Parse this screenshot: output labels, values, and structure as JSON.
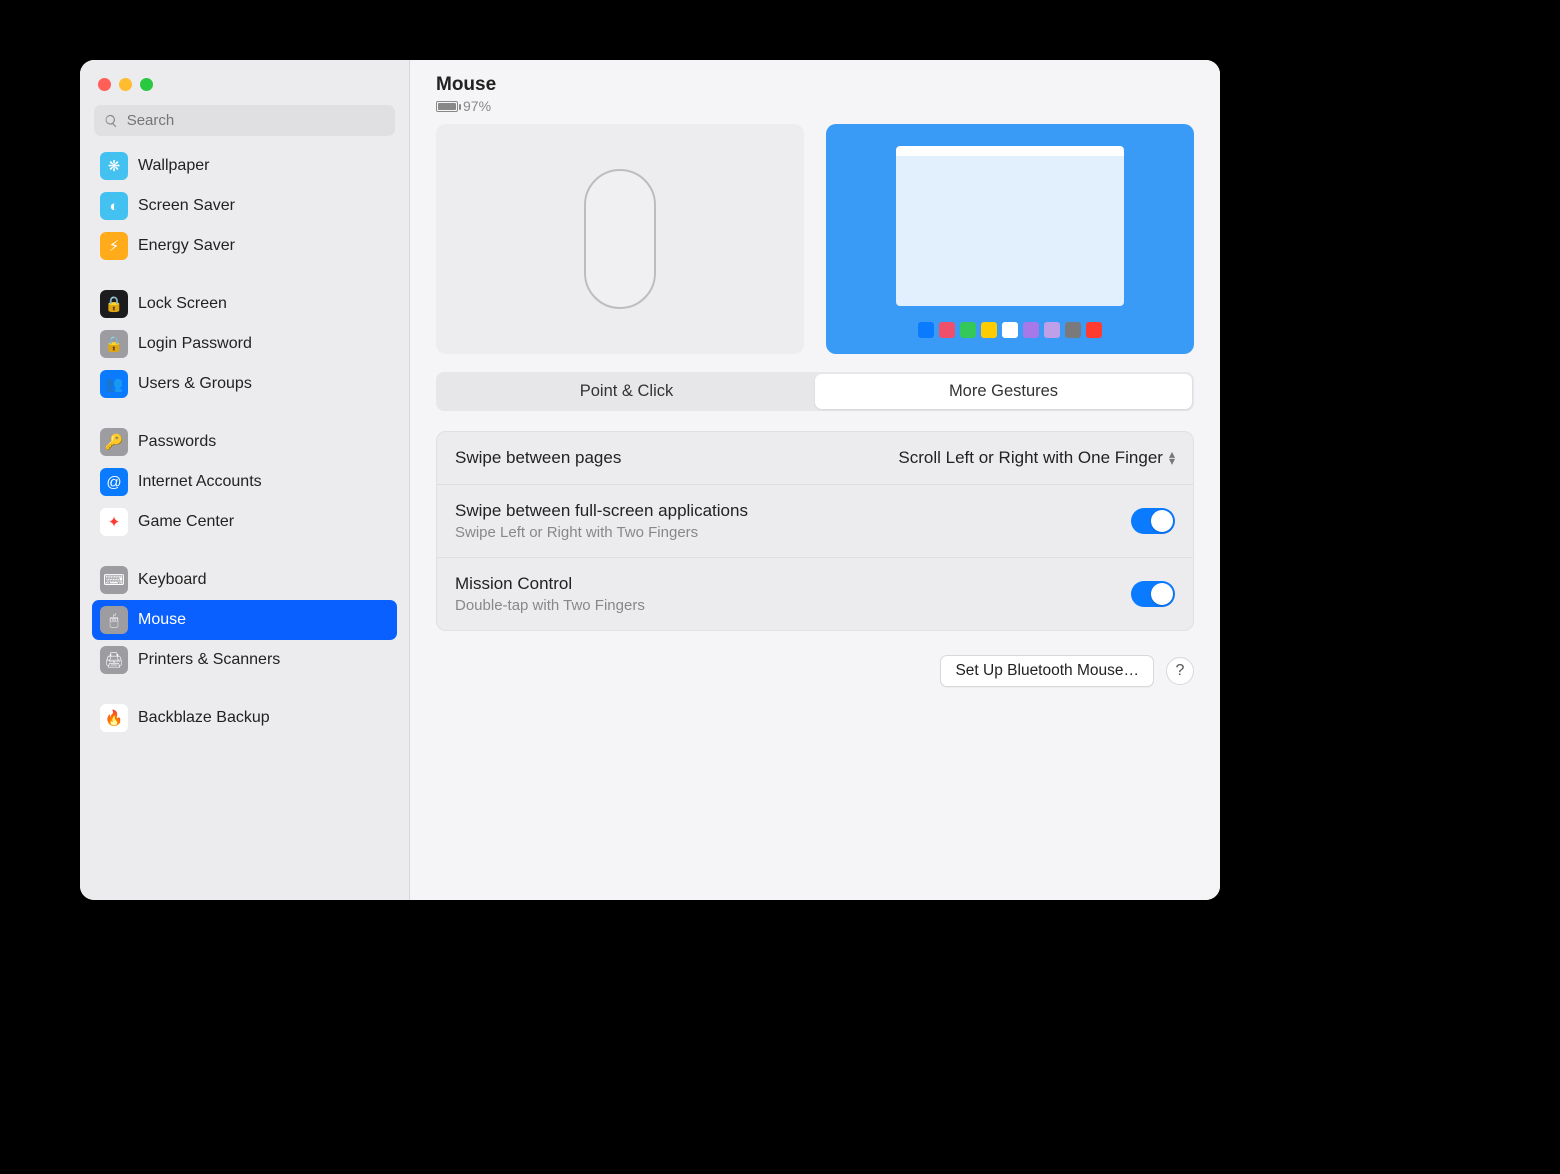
{
  "search": {
    "placeholder": "Search"
  },
  "sidebar": {
    "groups": [
      {
        "items": [
          {
            "id": "wallpaper",
            "label": "Wallpaper",
            "icon": "❋",
            "bg": "#43c1f0"
          },
          {
            "id": "screen-saver",
            "label": "Screen Saver",
            "icon": "◐",
            "bg": "#43c1f0"
          },
          {
            "id": "energy-saver",
            "label": "Energy Saver",
            "icon": "⚡︎",
            "bg": "#ffab1a"
          }
        ]
      },
      {
        "items": [
          {
            "id": "lock-screen",
            "label": "Lock Screen",
            "icon": "🔒",
            "bg": "#1c1c1e"
          },
          {
            "id": "login-password",
            "label": "Login Password",
            "icon": "🔒",
            "bg": "#9c9ca1"
          },
          {
            "id": "users-groups",
            "label": "Users & Groups",
            "icon": "👥",
            "bg": "#0a7aff"
          }
        ]
      },
      {
        "items": [
          {
            "id": "passwords",
            "label": "Passwords",
            "icon": "🔑",
            "bg": "#9c9ca1"
          },
          {
            "id": "internet-accounts",
            "label": "Internet Accounts",
            "icon": "@",
            "bg": "#0a7aff"
          },
          {
            "id": "game-center",
            "label": "Game Center",
            "icon": "✦",
            "bg": "#ffffff"
          }
        ]
      },
      {
        "items": [
          {
            "id": "keyboard",
            "label": "Keyboard",
            "icon": "⌨",
            "bg": "#9c9ca1"
          },
          {
            "id": "mouse",
            "label": "Mouse",
            "icon": "🖱",
            "bg": "#9c9ca1",
            "selected": true
          },
          {
            "id": "printers-scanners",
            "label": "Printers & Scanners",
            "icon": "🖨",
            "bg": "#9c9ca1"
          }
        ]
      },
      {
        "items": [
          {
            "id": "backblaze",
            "label": "Backblaze Backup",
            "icon": "🔥",
            "bg": "#ffffff"
          }
        ]
      }
    ]
  },
  "page": {
    "title": "Mouse",
    "battery_pct": "97%",
    "battery_fill_pct": 97
  },
  "tabs": {
    "point_click": "Point & Click",
    "more_gestures": "More Gestures",
    "active": "more_gestures"
  },
  "settings": {
    "swipe_pages": {
      "label": "Swipe between pages",
      "value": "Scroll Left or Right with One Finger"
    },
    "swipe_fullscreen": {
      "label": "Swipe between full-screen applications",
      "sub": "Swipe Left or Right with Two Fingers",
      "on": true
    },
    "mission_control": {
      "label": "Mission Control",
      "sub": "Double-tap with Two Fingers",
      "on": true
    }
  },
  "footer": {
    "setup_bt": "Set Up Bluetooth Mouse…",
    "help": "?"
  },
  "dock_colors": [
    "#0a7aff",
    "#ef4f6b",
    "#34c759",
    "#ffcc00",
    "#ffffff",
    "#a678e8",
    "#bfa0e8",
    "#7a7a7d",
    "#ff3b30"
  ]
}
